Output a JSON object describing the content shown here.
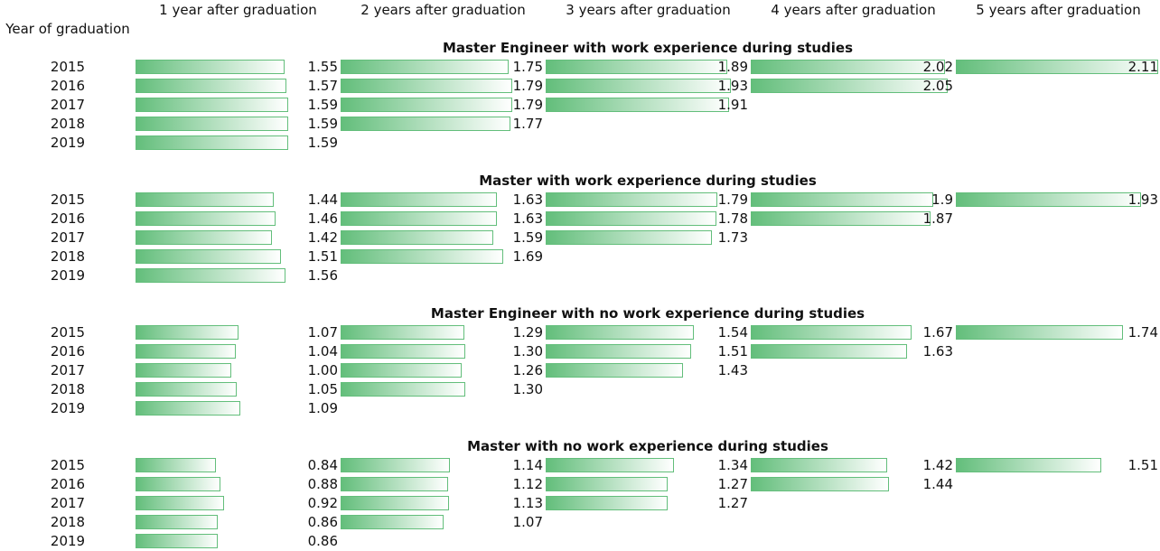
{
  "chart_data": {
    "type": "table",
    "row_header": "Year of graduation",
    "columns": [
      "1 year after graduation",
      "2 years after graduation",
      "3 years after graduation",
      "4 years after graduation",
      "5 years after graduation"
    ],
    "bar_color": "#63be7b",
    "sections": [
      {
        "title": "Master Engineer with work experience during studies",
        "rows": [
          {
            "year": "2015",
            "values": [
              "1.55",
              "1.75",
              "1.89",
              "2.02",
              "2.11"
            ]
          },
          {
            "year": "2016",
            "values": [
              "1.57",
              "1.79",
              "1.93",
              "2.05"
            ]
          },
          {
            "year": "2017",
            "values": [
              "1.59",
              "1.79",
              "1.91"
            ]
          },
          {
            "year": "2018",
            "values": [
              "1.59",
              "1.77"
            ]
          },
          {
            "year": "2019",
            "values": [
              "1.59"
            ]
          }
        ]
      },
      {
        "title": "Master with work experience during studies",
        "rows": [
          {
            "year": "2015",
            "values": [
              "1.44",
              "1.63",
              "1.79",
              "1.9",
              "1.93"
            ]
          },
          {
            "year": "2016",
            "values": [
              "1.46",
              "1.63",
              "1.78",
              "1.87"
            ]
          },
          {
            "year": "2017",
            "values": [
              "1.42",
              "1.59",
              "1.73"
            ]
          },
          {
            "year": "2018",
            "values": [
              "1.51",
              "1.69"
            ]
          },
          {
            "year": "2019",
            "values": [
              "1.56"
            ]
          }
        ]
      },
      {
        "title": "Master Engineer with no work experience during studies",
        "rows": [
          {
            "year": "2015",
            "values": [
              "1.07",
              "1.29",
              "1.54",
              "1.67",
              "1.74"
            ]
          },
          {
            "year": "2016",
            "values": [
              "1.04",
              "1.30",
              "1.51",
              "1.63"
            ]
          },
          {
            "year": "2017",
            "values": [
              "1.00",
              "1.26",
              "1.43"
            ]
          },
          {
            "year": "2018",
            "values": [
              "1.05",
              "1.30"
            ]
          },
          {
            "year": "2019",
            "values": [
              "1.09"
            ]
          }
        ]
      },
      {
        "title": "Master with no work experience during studies",
        "rows": [
          {
            "year": "2015",
            "values": [
              "0.84",
              "1.14",
              "1.34",
              "1.42",
              "1.51"
            ]
          },
          {
            "year": "2016",
            "values": [
              "0.88",
              "1.12",
              "1.27",
              "1.44"
            ]
          },
          {
            "year": "2017",
            "values": [
              "0.92",
              "1.13",
              "1.27"
            ]
          },
          {
            "year": "2018",
            "values": [
              "0.86",
              "1.07"
            ]
          },
          {
            "year": "2019",
            "values": [
              "0.86"
            ]
          }
        ]
      }
    ]
  }
}
